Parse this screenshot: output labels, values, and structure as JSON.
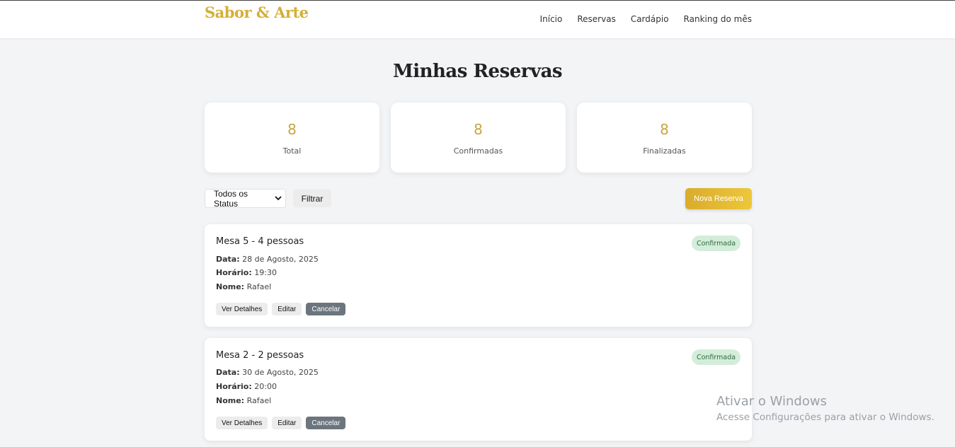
{
  "brand": {
    "name": "Sabor & Arte",
    "accent": "#d4af37"
  },
  "nav": {
    "items": [
      {
        "label": "Início"
      },
      {
        "label": "Reservas"
      },
      {
        "label": "Cardápio"
      },
      {
        "label": "Ranking do mês"
      }
    ]
  },
  "page": {
    "title": "Minhas Reservas"
  },
  "stats": [
    {
      "value": "8",
      "label": "Total"
    },
    {
      "value": "8",
      "label": "Confirmadas"
    },
    {
      "value": "8",
      "label": "Finalizadas"
    }
  ],
  "filters": {
    "status_select": {
      "value": "Todos os Status",
      "icon": "chevron-down-icon"
    },
    "filter_label": "Filtrar",
    "new_label": "Nova Reserva"
  },
  "reservations": [
    {
      "title": "Mesa 5 - 4 pessoas",
      "status": "Confirmada",
      "date_label": "Data:",
      "date": "28 de Agosto, 2025",
      "time_label": "Horário:",
      "time": "19:30",
      "name_label": "Nome:",
      "name": "Rafael",
      "details_label": "Ver Detalhes",
      "edit_label": "Editar",
      "cancel_label": "Cancelar"
    },
    {
      "title": "Mesa 2 - 2 pessoas",
      "status": "Confirmada",
      "date_label": "Data:",
      "date": "30 de Agosto, 2025",
      "time_label": "Horário:",
      "time": "20:00",
      "name_label": "Nome:",
      "name": "Rafael",
      "details_label": "Ver Detalhes",
      "edit_label": "Editar",
      "cancel_label": "Cancelar"
    }
  ],
  "watermark": {
    "title": "Ativar o Windows",
    "subtitle": "Acesse Configurações para ativar o Windows."
  },
  "colors": {
    "badge_bg": "#d4edda",
    "badge_text": "#2d6b3a",
    "cancel_bg": "#6c757d",
    "stat_value": "#c9a641"
  }
}
